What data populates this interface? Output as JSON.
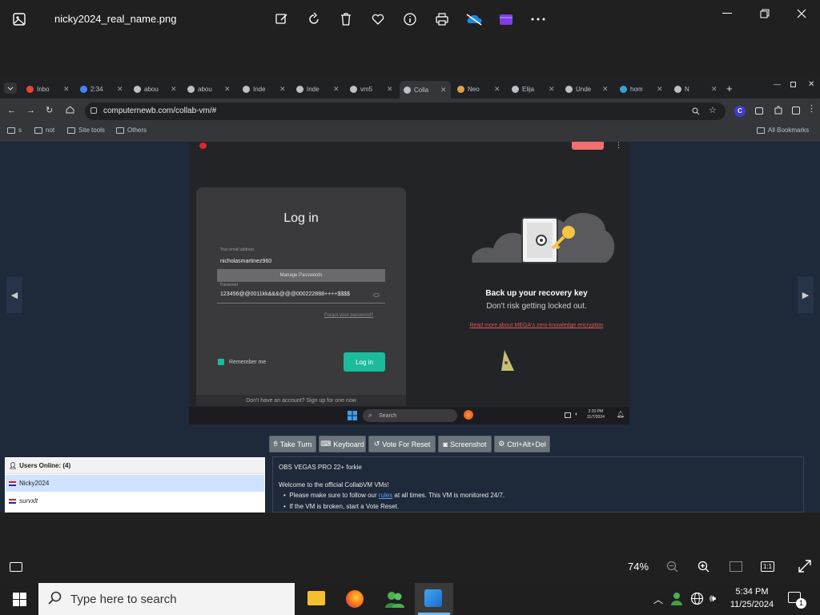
{
  "photos_app": {
    "file_name": "nicky2024_real_name.png",
    "zoom": "74%",
    "toolbar_icons": [
      "edit-icon",
      "rotate-icon",
      "delete-icon",
      "heart-icon",
      "info-icon",
      "print-icon",
      "onedrive-icon",
      "clipchamp-icon",
      "more-icon"
    ]
  },
  "browser": {
    "tabs": [
      {
        "label": "Inbo",
        "favicon": "gmail",
        "color": "#ea4335"
      },
      {
        "label": "2:34",
        "favicon": "bars",
        "color": "#4285f4"
      },
      {
        "label": "abou",
        "favicon": "globe",
        "color": "#bdc1c6"
      },
      {
        "label": "abou",
        "favicon": "globe",
        "color": "#bdc1c6"
      },
      {
        "label": "Inde",
        "favicon": "doc",
        "color": "#bdc1c6"
      },
      {
        "label": "Inde",
        "favicon": "doc",
        "color": "#bdc1c6"
      },
      {
        "label": "vm5",
        "favicon": "vm",
        "color": "#bdc1c6"
      },
      {
        "label": "Colla",
        "favicon": "vm",
        "color": "#bdc1c6"
      },
      {
        "label": "Neo",
        "favicon": "cat",
        "color": "#e0a050"
      },
      {
        "label": "Elija",
        "favicon": "globe",
        "color": "#bdc1c6"
      },
      {
        "label": "Unde",
        "favicon": "globe",
        "color": "#bdc1c6"
      },
      {
        "label": "hom",
        "favicon": "earth",
        "color": "#3aa0d0"
      },
      {
        "label": "N",
        "favicon": "shield",
        "color": "#bdc1c6"
      }
    ],
    "url": "computernewb.com/collab-vm/#",
    "bookmarks": [
      "s",
      "not",
      "Site tools",
      "Others"
    ],
    "all_bookmarks": "All Bookmarks"
  },
  "vm": {
    "login": {
      "title": "Log in",
      "email_label": "Your email address",
      "email_value": "nicholasmartinez960",
      "manage_passwords": "Manage Passwords",
      "password_label": "Password",
      "password_value": "123456@@0011kk&&&@@@000222888++++$$$$",
      "forgot": "Forgot your password?",
      "remember": "Remember me",
      "login_button": "Log in",
      "signup": "Don't have an account? Sign up for one now"
    },
    "recovery": {
      "title": "Back up your recovery key",
      "subtitle": "Don't risk getting locked out.",
      "link": "Read more about MEGA's zero-knowledge encryption"
    },
    "taskbar": {
      "search": "Search",
      "time": "2:33 PM",
      "date": "11/7/2024"
    }
  },
  "controls": [
    "Take Turn",
    "Keyboard",
    "Vote For Reset",
    "Screenshot",
    "Ctrl+Alt+Del"
  ],
  "users": {
    "header": "Users Online: (4)",
    "list": [
      "Nicky2024",
      "survxlt"
    ]
  },
  "chat": {
    "line1": "OBS VEGAS PRO 22+ forkie",
    "line2": "Welcome to the official CollabVM VMs!",
    "bullet1_pre": "Please make sure to follow our ",
    "bullet1_link": "rules",
    "bullet1_post": " at all times. This VM is monitored 24/7.",
    "bullet2": "If the VM is broken, start a Vote Reset."
  },
  "windows": {
    "search_placeholder": "Type here to search",
    "time": "5:34 PM",
    "date": "11/25/2024",
    "notifications": "1"
  }
}
